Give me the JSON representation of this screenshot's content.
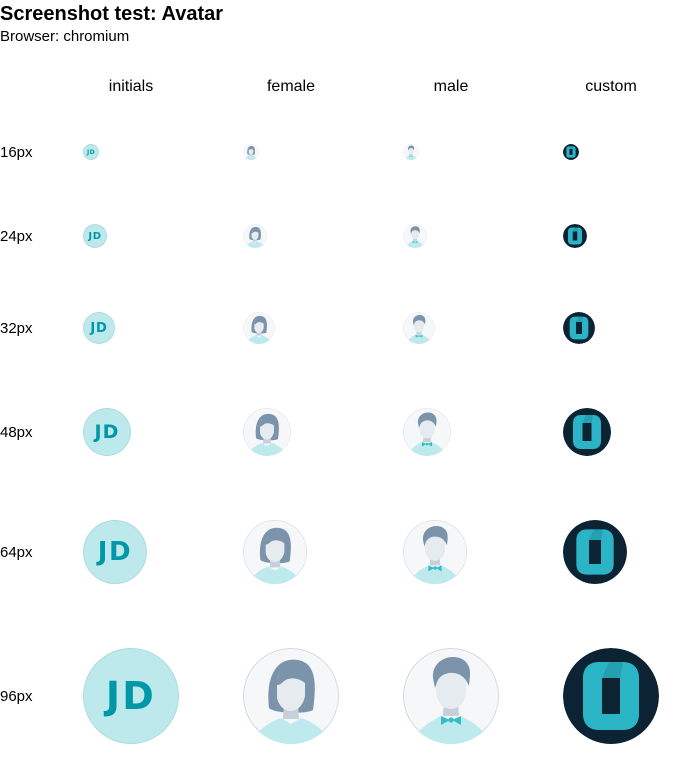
{
  "page": {
    "title": "Screenshot test: Avatar",
    "browser_text": "Browser: chromium"
  },
  "columns": [
    {
      "label": "initials"
    },
    {
      "label": "female"
    },
    {
      "label": "male"
    },
    {
      "label": "custom"
    }
  ],
  "rows": [
    {
      "label": "16px"
    },
    {
      "label": "24px"
    },
    {
      "label": "32px"
    },
    {
      "label": "48px"
    },
    {
      "label": "64px"
    },
    {
      "label": "96px"
    }
  ],
  "avatar": {
    "initials": "JD",
    "initials_bg": "#bde9ec",
    "initials_color": "#0097a7",
    "placeholder_bg": "#f5f7f9",
    "placeholder_border": "#d3d9df",
    "hair_color": "#7b93ab",
    "face_color": "#e6ebf0",
    "neck_color": "#c6d0da",
    "shirt_color": "#bfeaed",
    "tie_color": "#33bdc9",
    "custom_bg": "#0c2333",
    "custom_logo_color": "#2ab4c5",
    "custom_icon": "o-logo-icon"
  }
}
